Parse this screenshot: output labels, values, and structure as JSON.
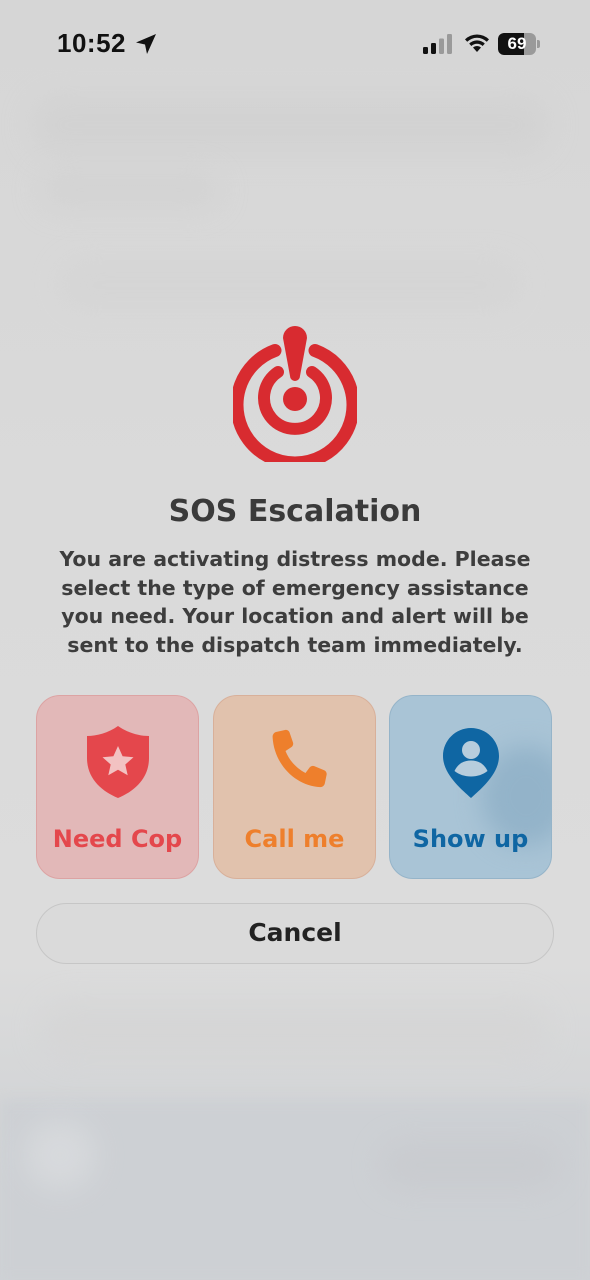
{
  "status_bar": {
    "time": "10:52",
    "battery_level": 69,
    "battery_label": "69",
    "location_icon": "location-arrow-icon",
    "signal_icon": "cellular-signal-icon",
    "wifi_icon": "wifi-icon"
  },
  "dialog": {
    "icon": "sos-alert-icon",
    "title": "SOS Escalation",
    "description": "You are activating distress mode. Please select the type of emergency assistance you need. Your location and alert will be sent to the dispatch team immediately.",
    "options": [
      {
        "label": "Need Cop",
        "icon": "police-badge-icon",
        "color": "#e4474c",
        "background": "#e2b8b8"
      },
      {
        "label": "Call me",
        "icon": "phone-icon",
        "color": "#ee7f2c",
        "background": "#e1c2ad"
      },
      {
        "label": "Show up",
        "icon": "person-pin-icon",
        "color": "#0f66a3",
        "background": "#a9c4d6"
      }
    ],
    "cancel_label": "Cancel"
  },
  "colors": {
    "sos_red": "#d82b30",
    "title_text": "#3a3a3a",
    "background": "#d9d9d9"
  }
}
